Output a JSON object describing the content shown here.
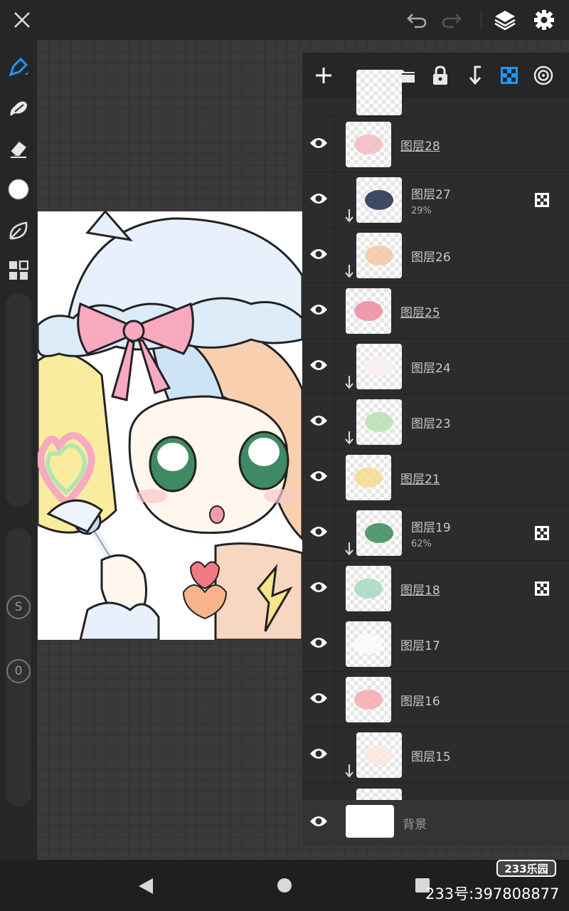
{
  "topbar": {
    "close": "close-icon",
    "undo": "undo-icon",
    "redo": "redo-icon",
    "layers": "layers-icon",
    "settings": "gear-icon"
  },
  "toolbar": {
    "tools": [
      "pen-icon",
      "smudge-icon",
      "eraser-icon",
      "color-swatch",
      "leaf-icon",
      "grid-icon"
    ],
    "active_color": "#2196f3",
    "size_label": "S",
    "opacity_label": "0"
  },
  "layers_panel": {
    "header_icons": [
      "add-icon",
      "folder-icon",
      "lock-icon",
      "merge-down-icon",
      "alpha-lock-icon",
      "target-icon"
    ],
    "layers": [
      {
        "name": "图层28",
        "opacity": "",
        "clipped": false,
        "underlined": true,
        "alpha_locked": false,
        "thumb": "#f5b8c4"
      },
      {
        "name": "图层27",
        "opacity": "29%",
        "clipped": true,
        "underlined": false,
        "alpha_locked": true,
        "thumb": "#1e2a4a"
      },
      {
        "name": "图层26",
        "opacity": "",
        "clipped": true,
        "underlined": false,
        "alpha_locked": false,
        "thumb": "#f4c8a0"
      },
      {
        "name": "图层25",
        "opacity": "",
        "clipped": false,
        "underlined": true,
        "alpha_locked": false,
        "thumb": "#f08aa0"
      },
      {
        "name": "图层24",
        "opacity": "",
        "clipped": true,
        "underlined": false,
        "alpha_locked": false,
        "thumb": "#f8f0f0"
      },
      {
        "name": "图层23",
        "opacity": "",
        "clipped": true,
        "underlined": false,
        "alpha_locked": false,
        "thumb": "#b8e0b0"
      },
      {
        "name": "图层21",
        "opacity": "",
        "clipped": false,
        "underlined": true,
        "alpha_locked": false,
        "thumb": "#f8d890"
      },
      {
        "name": "图层19",
        "opacity": "62%",
        "clipped": true,
        "underlined": false,
        "alpha_locked": true,
        "thumb": "#3a8a5a"
      },
      {
        "name": "图层18",
        "opacity": "",
        "clipped": false,
        "underlined": true,
        "alpha_locked": true,
        "thumb": "#a8d8c0"
      },
      {
        "name": "图层17",
        "opacity": "",
        "clipped": false,
        "underlined": false,
        "alpha_locked": false,
        "thumb": "#fafafa"
      },
      {
        "name": "图层16",
        "opacity": "",
        "clipped": false,
        "underlined": false,
        "alpha_locked": false,
        "thumb": "#f7a8b0"
      },
      {
        "name": "图层15",
        "opacity": "",
        "clipped": true,
        "underlined": false,
        "alpha_locked": false,
        "thumb": "#fbe8e0"
      }
    ],
    "background_layer": "背景"
  },
  "watermark": {
    "logo": "233乐园",
    "id": "233号:397808877"
  }
}
